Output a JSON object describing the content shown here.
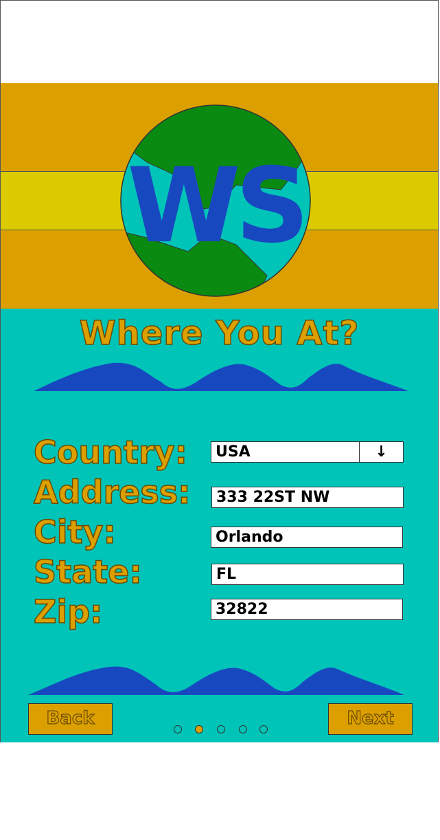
{
  "header": {
    "logo_text": "WS",
    "colors": {
      "band": "#dba000",
      "stripe": "#dcca00",
      "globe_water": "#00c4b8",
      "globe_land": "#0a8a10",
      "logo_letters": "#1848c0"
    }
  },
  "form": {
    "title": "Where You At?",
    "fields": [
      {
        "label": "Country:",
        "value": "USA",
        "type": "select"
      },
      {
        "label": "Address:",
        "value": "333 22ST NW",
        "type": "text"
      },
      {
        "label": "City:",
        "value": "Orlando",
        "type": "text"
      },
      {
        "label": "State:",
        "value": "FL",
        "type": "text"
      },
      {
        "label": "Zip:",
        "value": "32822",
        "type": "text"
      }
    ],
    "select_arrow_icon": "↓"
  },
  "nav": {
    "back_label": "Back",
    "next_label": "Next",
    "page_indicator": {
      "total": 5,
      "active": 2
    }
  },
  "theme": {
    "background": "#00c4b8",
    "accent": "#dba000",
    "wave": "#1848c0"
  }
}
